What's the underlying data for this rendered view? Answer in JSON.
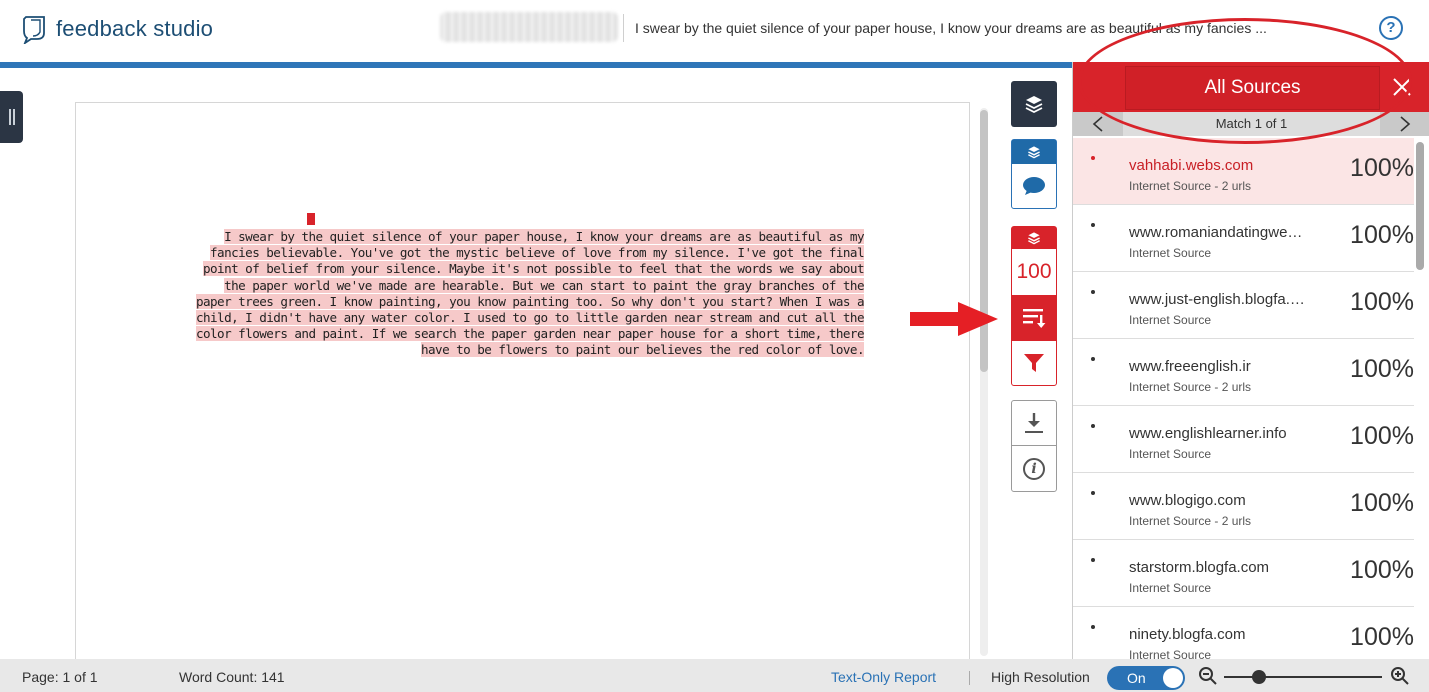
{
  "header": {
    "app_name": "feedback studio",
    "document_title": "I swear by the quiet silence of your paper house, I know your dreams are as beautiful as my fancies ...",
    "help_label": "?"
  },
  "document": {
    "match_marker_text": "1",
    "paragraph": "I swear by the quiet silence of your paper house, I know your dreams are as beautiful as my fancies believable. You've got the mystic believe of love from my silence. I've got the final point of belief from your silence. Maybe it's not possible to feel that the words we say about the paper world we've made are hearable. But we can start to paint the gray branches of the paper trees green. I know painting, you know painting too. So why don't you start? When I was a child, I didn't have any water color. I used to go to little garden near stream and cut all the color flowers and paint. If we search the paper garden near paper house for a short time, there have to be flowers to paint our believes the red color of love."
  },
  "toolbar": {
    "similarity_score": "100"
  },
  "sources_panel": {
    "title": "All Sources",
    "match_label": "Match 1 of 1",
    "sources": [
      {
        "name": "vahhabi.webs.com",
        "type": "Internet Source - 2 urls",
        "percent": "100%",
        "active": true
      },
      {
        "name": "www.romaniandatingwebsite.com",
        "type": "Internet Source",
        "percent": "100%"
      },
      {
        "name": "www.just-english.blogfa.com",
        "type": "Internet Source",
        "percent": "100%"
      },
      {
        "name": "www.freeenglish.ir",
        "type": "Internet Source - 2 urls",
        "percent": "100%"
      },
      {
        "name": "www.englishlearner.info",
        "type": "Internet Source",
        "percent": "100%"
      },
      {
        "name": "www.blogigo.com",
        "type": "Internet Source - 2 urls",
        "percent": "100%"
      },
      {
        "name": "starstorm.blogfa.com",
        "type": "Internet Source",
        "percent": "100%"
      },
      {
        "name": "ninety.blogfa.com",
        "type": "Internet Source",
        "percent": "100%"
      }
    ]
  },
  "footer": {
    "page_label": "Page: 1 of 1",
    "word_count_label": "Word Count: 141",
    "text_only_report": "Text-Only Report",
    "high_resolution_label": "High Resolution",
    "toggle_state": "On",
    "zoom_level": 0.22
  },
  "colors": {
    "accent_red": "#d8232a",
    "accent_blue": "#2a72b5",
    "highlight": "#f6c9c9"
  },
  "icons": [
    "feedback-studio-logo-icon",
    "help-icon",
    "layers-icon",
    "comment-icon",
    "sort-icon",
    "filter-icon",
    "download-icon",
    "info-icon",
    "close-icon",
    "chevron-left-icon",
    "chevron-right-icon",
    "zoom-out-icon",
    "zoom-in-icon"
  ]
}
